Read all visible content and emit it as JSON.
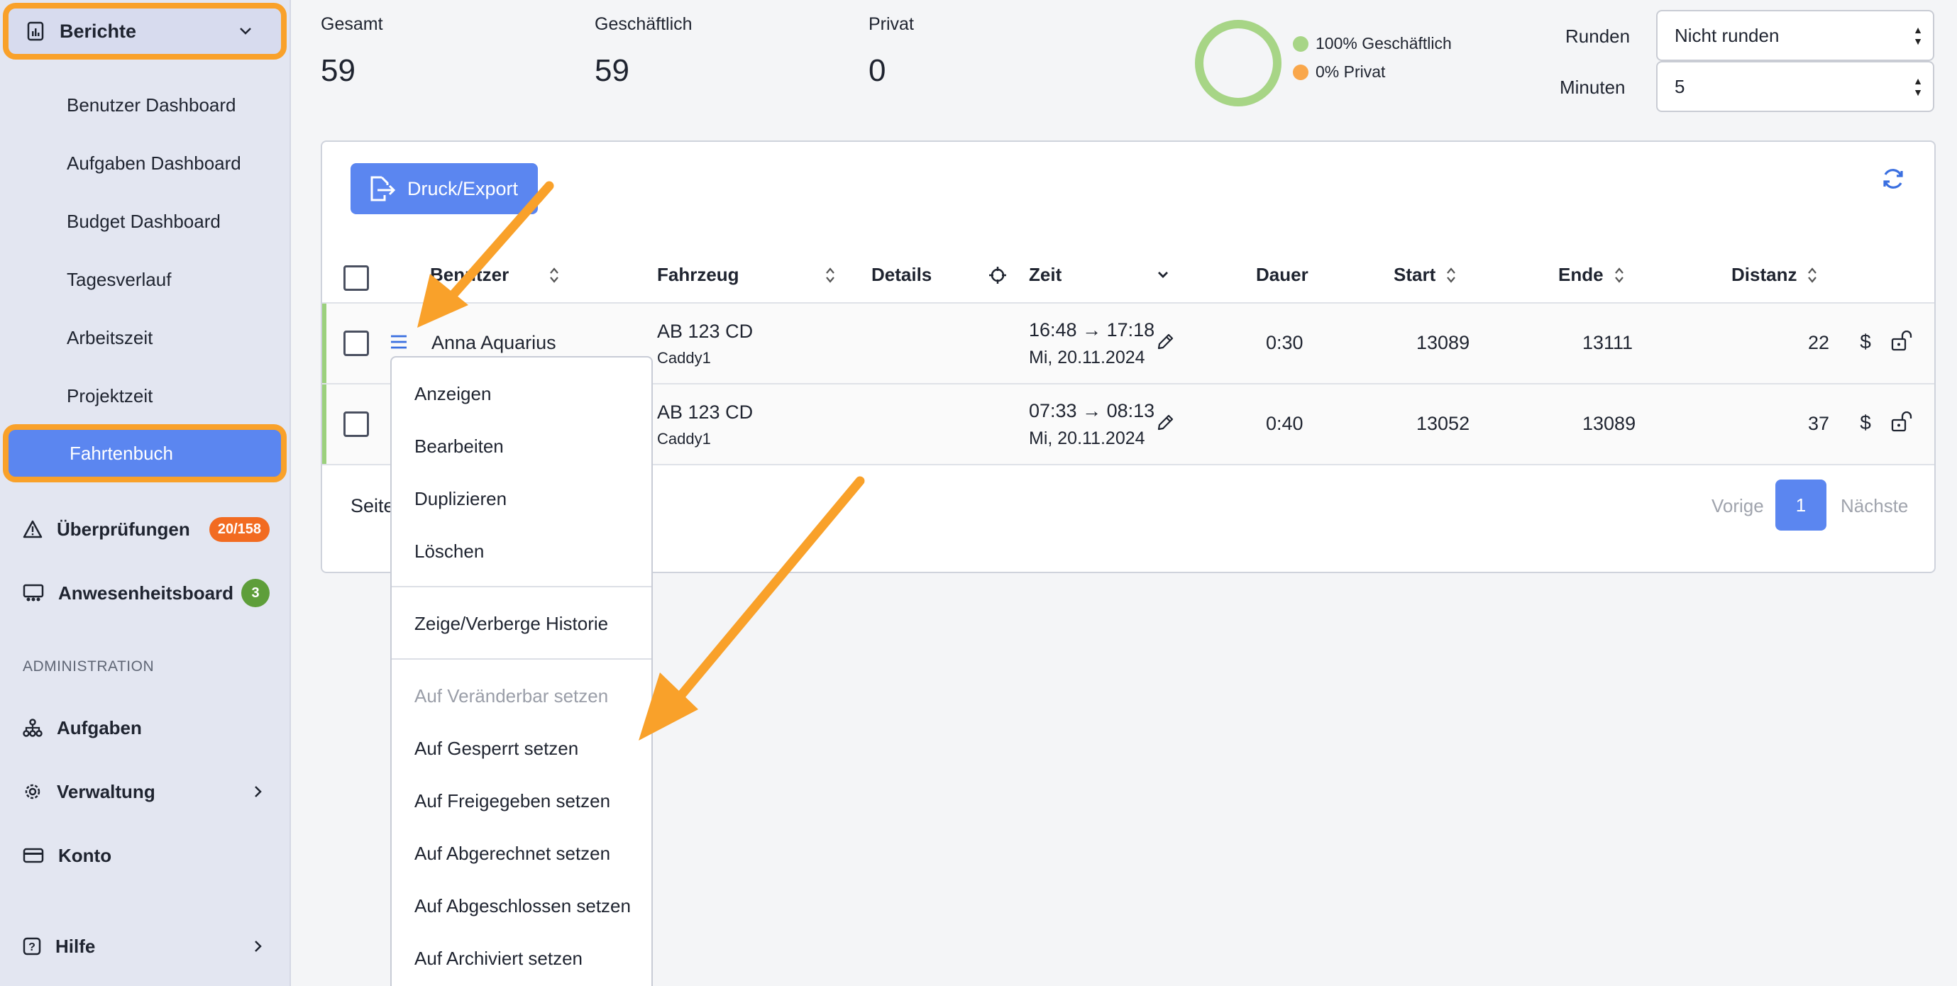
{
  "sidebar": {
    "reports": {
      "label": "Berichte",
      "icon": "report-icon"
    },
    "sub_items": [
      {
        "label": "Benutzer Dashboard"
      },
      {
        "label": "Aufgaben Dashboard"
      },
      {
        "label": "Budget Dashboard"
      },
      {
        "label": "Tagesverlauf"
      },
      {
        "label": "Arbeitszeit"
      },
      {
        "label": "Projektzeit"
      }
    ],
    "active_item": {
      "label": "Fahrtenbuch"
    },
    "checks": {
      "label": "Überprüfungen",
      "badge": "20/158"
    },
    "presence": {
      "label": "Anwesenheitsboard",
      "badge": "3"
    },
    "section_admin": "ADMINISTRATION",
    "tasks": {
      "label": "Aufgaben"
    },
    "admin": {
      "label": "Verwaltung"
    },
    "account": {
      "label": "Konto"
    },
    "help": {
      "label": "Hilfe"
    }
  },
  "stats": {
    "total": {
      "label": "Gesamt",
      "value": "59"
    },
    "business": {
      "label": "Geschäftlich",
      "value": "59"
    },
    "private": {
      "label": "Privat",
      "value": "0"
    }
  },
  "donut": {
    "business_fraction": 1.0,
    "legend_business": "100% Geschäftlich",
    "legend_private": "0% Privat",
    "color_business": "#a7d586",
    "color_private": "#f9a74b"
  },
  "controls": {
    "round_label": "Runden",
    "round_value": "Nicht runden",
    "minutes_label": "Minuten",
    "minutes_value": "5"
  },
  "toolbar": {
    "export_label": "Druck/Export"
  },
  "table": {
    "headers": {
      "user": "Benutzer",
      "vehicle": "Fahrzeug",
      "details": "Details",
      "time": "Zeit",
      "duration": "Dauer",
      "start": "Start",
      "end": "Ende",
      "distance": "Distanz"
    },
    "rows": [
      {
        "user": "Anna Aquarius",
        "plate": "AB 123 CD",
        "car": "Caddy1",
        "time_range": "16:48 → 17:18",
        "date": "Mi, 20.11.2024",
        "duration": "0:30",
        "start": "13089",
        "end": "13111",
        "distance": "22"
      },
      {
        "user": "",
        "plate": "AB 123 CD",
        "car": "Caddy1",
        "time_range": "07:33 → 08:13",
        "date": "Mi, 20.11.2024",
        "duration": "0:40",
        "start": "13052",
        "end": "13089",
        "distance": "37"
      }
    ],
    "footer_left": "Seite"
  },
  "pager": {
    "prev": "Vorige",
    "current": "1",
    "next": "Nächste"
  },
  "context_menu": {
    "items": [
      "Anzeigen",
      "Bearbeiten",
      "Duplizieren",
      "Löschen",
      "Zeige/Verberge Historie",
      "Auf Veränderbar setzen",
      "Auf Gesperrt setzen",
      "Auf Freigegeben setzen",
      "Auf Abgerechnet setzen",
      "Auf Abgeschlossen setzen",
      "Auf Archiviert setzen"
    ]
  },
  "colors": {
    "accent_blue": "#5b86f0",
    "highlight_orange": "#f9a12a",
    "badge_orange": "#f26b21",
    "badge_green": "#5e9e3a",
    "row_accent_green": "#9bd07d"
  }
}
